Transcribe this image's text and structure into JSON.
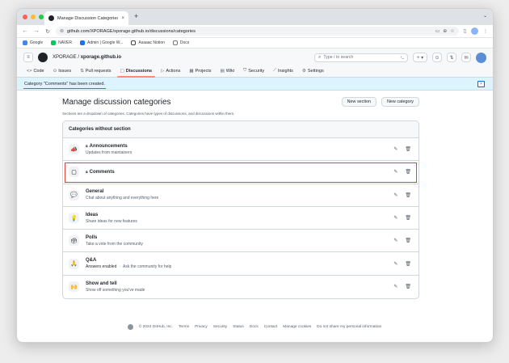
{
  "browser": {
    "tab_title": "Manage Discussion Categories",
    "url": "github.com/XPORAGE/xporage.github.io/discussions/categories",
    "bookmarks": [
      {
        "label": "Google",
        "color": "#4285f4"
      },
      {
        "label": "NAVER",
        "color": "#03c75a"
      },
      {
        "label": "Admin | Google W...",
        "color": "#1a73e8"
      },
      {
        "label": "Asaaac Notion",
        "color": "#444444"
      },
      {
        "label": "Docs",
        "color": "#9aa0a6"
      }
    ]
  },
  "gh_header": {
    "owner": "XPORAGE",
    "separator": "/",
    "repo": "xporage.github.io",
    "search_placeholder": "Type / to search",
    "plus_label": "+ ▾"
  },
  "repo_nav": [
    {
      "label": "Code",
      "icon": "<>"
    },
    {
      "label": "Issues",
      "icon": "⊙"
    },
    {
      "label": "Pull requests",
      "icon": "⇅"
    },
    {
      "label": "Discussions",
      "icon": "▢",
      "active": true
    },
    {
      "label": "Actions",
      "icon": "▷"
    },
    {
      "label": "Projects",
      "icon": "▦"
    },
    {
      "label": "Wiki",
      "icon": "▤"
    },
    {
      "label": "Security",
      "icon": "⛉"
    },
    {
      "label": "Insights",
      "icon": "⟋"
    },
    {
      "label": "Settings",
      "icon": "⚙"
    }
  ],
  "flash": {
    "message": "Category \"Comments\" has been created.",
    "close": "×"
  },
  "page": {
    "title": "Manage discussion categories",
    "new_section": "New section",
    "new_category": "New category",
    "description": "Sections are a dropdown of categories. Categories have types of discussions, and discussions within them.",
    "box_title": "Categories without section"
  },
  "categories": [
    {
      "name": "Announcements",
      "locked": true,
      "desc": "Updates from maintainers",
      "emoji": "📣",
      "answers": ""
    },
    {
      "name": "Comments",
      "locked": true,
      "desc": "",
      "emoji": "▢",
      "answers": "",
      "highlight": true
    },
    {
      "name": "General",
      "locked": false,
      "desc": "Chat about anything and everything here",
      "emoji": "💬",
      "answers": ""
    },
    {
      "name": "Ideas",
      "locked": false,
      "desc": "Share ideas for new features",
      "emoji": "💡",
      "answers": ""
    },
    {
      "name": "Polls",
      "locked": false,
      "desc": "Take a vote from the community",
      "emoji": "🗳",
      "answers": ""
    },
    {
      "name": "Q&A",
      "locked": false,
      "desc": "Ask the community for help",
      "emoji": "🙏",
      "answers": "Answers enabled"
    },
    {
      "name": "Show and tell",
      "locked": false,
      "desc": "Show off something you've made",
      "emoji": "🙌",
      "answers": ""
    }
  ],
  "footer": [
    "© 2024 GitHub, Inc.",
    "Terms",
    "Privacy",
    "Security",
    "Status",
    "Docs",
    "Contact",
    "Manage cookies",
    "Do not share my personal information"
  ],
  "colors": {
    "accent_underline": "#fd8c73",
    "highlight_red": "#e0433a",
    "flash_bg": "#ddf4ff"
  }
}
